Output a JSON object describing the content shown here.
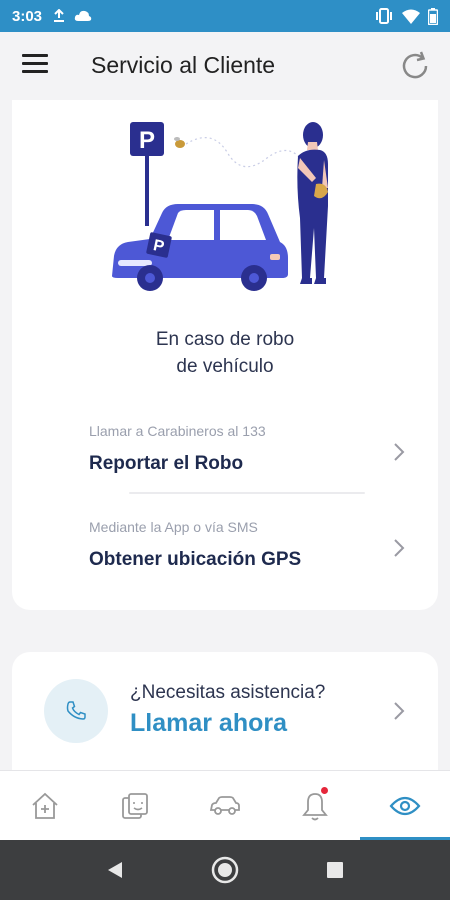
{
  "status_bar": {
    "time": "3:03"
  },
  "app_bar": {
    "title": "Servicio al Cliente"
  },
  "theft_card": {
    "headline_line1": "En caso de robo",
    "headline_line2": "de vehículo",
    "parking_sign": "P",
    "options": [
      {
        "subtitle": "Llamar a Carabineros al 133",
        "title": "Reportar el Robo"
      },
      {
        "subtitle": "Mediante la App o vía SMS",
        "title": "Obtener ubicación GPS"
      }
    ]
  },
  "assist_card": {
    "question": "¿Necesitas asistencia?",
    "action": "Llamar ahora"
  },
  "bottom_nav": {
    "items": [
      {
        "icon": "house-plus-icon"
      },
      {
        "icon": "cards-icon"
      },
      {
        "icon": "car-icon"
      },
      {
        "icon": "bell-icon",
        "badge": true
      },
      {
        "icon": "eye-icon",
        "active": true
      }
    ]
  },
  "colors": {
    "status_bar": "#2e8fc6",
    "accent": "#2f8fc4",
    "navy": "#1e2a4e",
    "illustration": "#4d58d6",
    "badge": "#e5263a"
  }
}
